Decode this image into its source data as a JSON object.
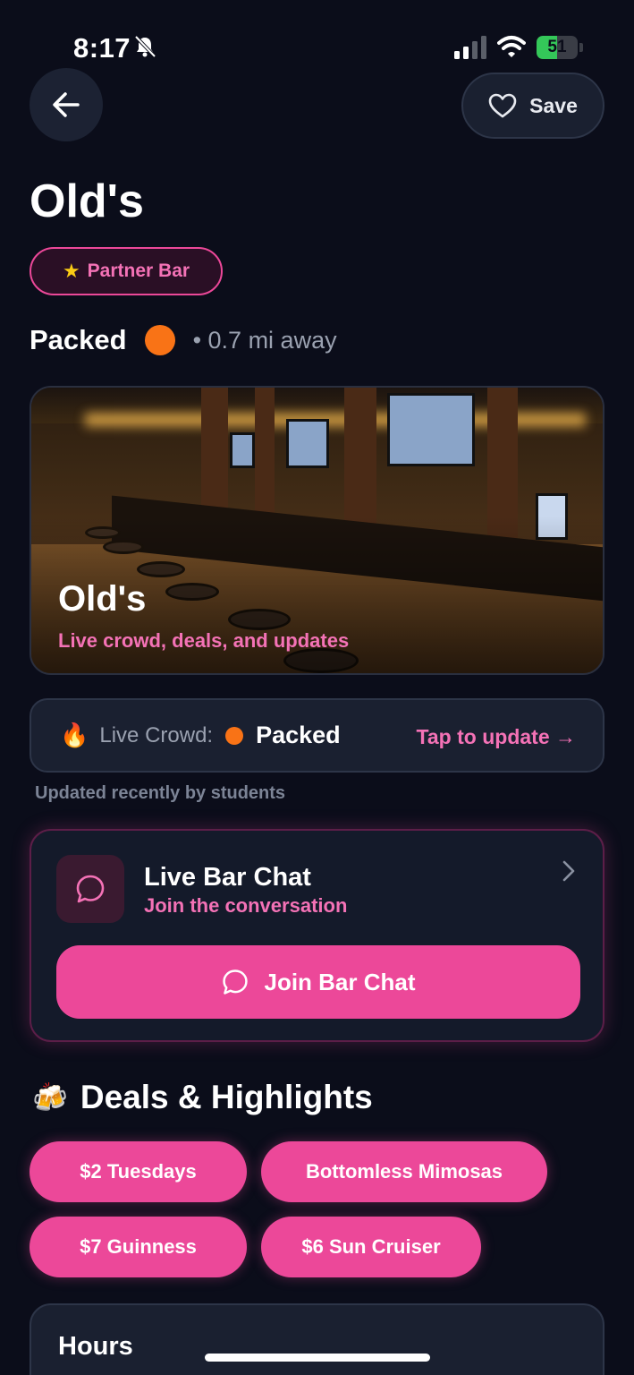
{
  "status_bar": {
    "time": "8:17",
    "battery_level": "51",
    "battery_fraction": 0.51
  },
  "header": {
    "save_label": "Save"
  },
  "venue": {
    "name": "Old's",
    "badge_label": "Partner Bar",
    "crowd_status": "Packed",
    "distance": "• 0.7 mi away"
  },
  "hero": {
    "title": "Old's",
    "subtitle": "Live crowd, deals, and updates"
  },
  "live_crowd": {
    "label": "Live Crowd:",
    "value": "Packed",
    "action": "Tap to update →",
    "updated_note": "Updated recently by students"
  },
  "chat": {
    "title": "Live Bar Chat",
    "subtitle": "Join the conversation",
    "button_label": "Join Bar Chat"
  },
  "deals": {
    "title": "Deals & Highlights",
    "items": [
      "$2 Tuesdays",
      "Bottomless Mimosas",
      "$7 Guinness",
      "$6 Sun Cruiser"
    ]
  },
  "hours": {
    "title": "Hours"
  },
  "colors": {
    "background": "#0b0d1a",
    "accent_pink": "#ec4899",
    "crowd_orange": "#f97316",
    "battery_green": "#34c759"
  },
  "icons": [
    "bell-slash-icon",
    "signal-icon",
    "wifi-icon",
    "battery-icon",
    "back-arrow-icon",
    "heart-icon",
    "star-icon",
    "fire-icon",
    "chat-bubble-icon",
    "chevron-right-icon",
    "beer-icon"
  ]
}
